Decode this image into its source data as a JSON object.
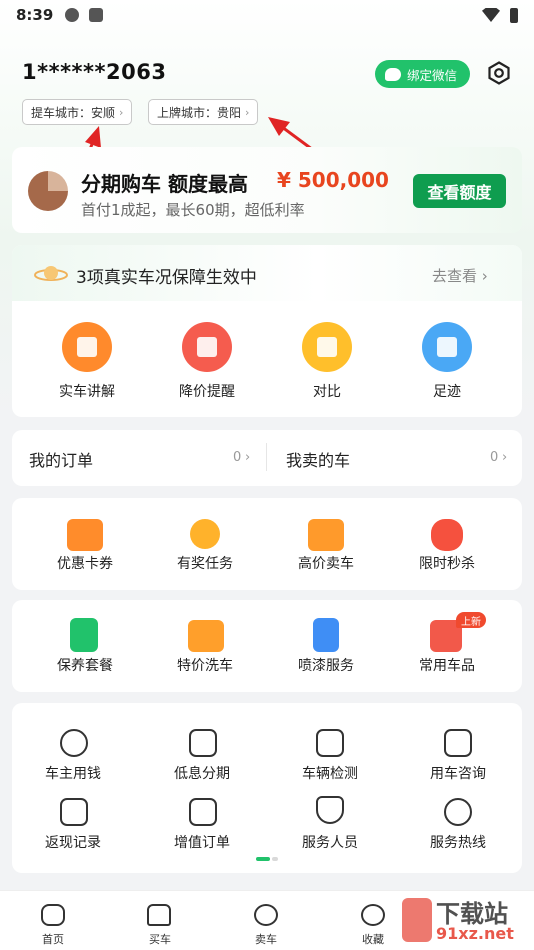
{
  "status_bar": {
    "time": "8:39"
  },
  "header": {
    "username": "1******2063",
    "bind_wechat_label": "绑定微信"
  },
  "cities": [
    {
      "label": "提车城市：安顺"
    },
    {
      "label": "上牌城市：贵阳"
    }
  ],
  "loan": {
    "title": "分期购车  额度最高",
    "amount": "¥ 500,000",
    "subtitle": "首付1成起，最长60期，超低利率",
    "button_label": "查看额度"
  },
  "guarantee": {
    "title": "3项真实车况保障生效中",
    "link_label": "去查看 ›"
  },
  "quick_actions": [
    {
      "label": "实车讲解",
      "color": "#ff8a2c"
    },
    {
      "label": "降价提醒",
      "color": "#f55c4e"
    },
    {
      "label": "对比",
      "color": "#ffbf2b"
    },
    {
      "label": "足迹",
      "color": "#4aa8f5"
    }
  ],
  "orders": {
    "my_orders": "我的订单",
    "my_orders_count": "0",
    "sold_cars": "我卖的车",
    "sold_cars_count": "0"
  },
  "grid1": [
    {
      "label": "优惠卡券",
      "color": "#ff8c2b"
    },
    {
      "label": "有奖任务",
      "color": "#ffb22b"
    },
    {
      "label": "高价卖车",
      "color": "#ff9a2b"
    },
    {
      "label": "限时秒杀",
      "color": "#f5513e"
    }
  ],
  "grid2": [
    {
      "label": "保养套餐",
      "color": "#21c26b"
    },
    {
      "label": "特价洗车",
      "color": "#ff9f2b"
    },
    {
      "label": "喷漆服务",
      "color": "#3f8ef5"
    },
    {
      "label": "常用车品",
      "color": "#f2594a"
    }
  ],
  "new_badge": "上新",
  "grid3": [
    {
      "label": "车主用钱"
    },
    {
      "label": "低息分期"
    },
    {
      "label": "车辆检测"
    },
    {
      "label": "用车咨询"
    },
    {
      "label": "返现记录"
    },
    {
      "label": "增值订单"
    },
    {
      "label": "服务人员"
    },
    {
      "label": "服务热线"
    }
  ],
  "tabbar": [
    {
      "label": "首页"
    },
    {
      "label": "买车"
    },
    {
      "label": "卖车"
    },
    {
      "label": "收藏"
    }
  ],
  "watermark": {
    "title": "下载站",
    "url": "91xz.net"
  }
}
